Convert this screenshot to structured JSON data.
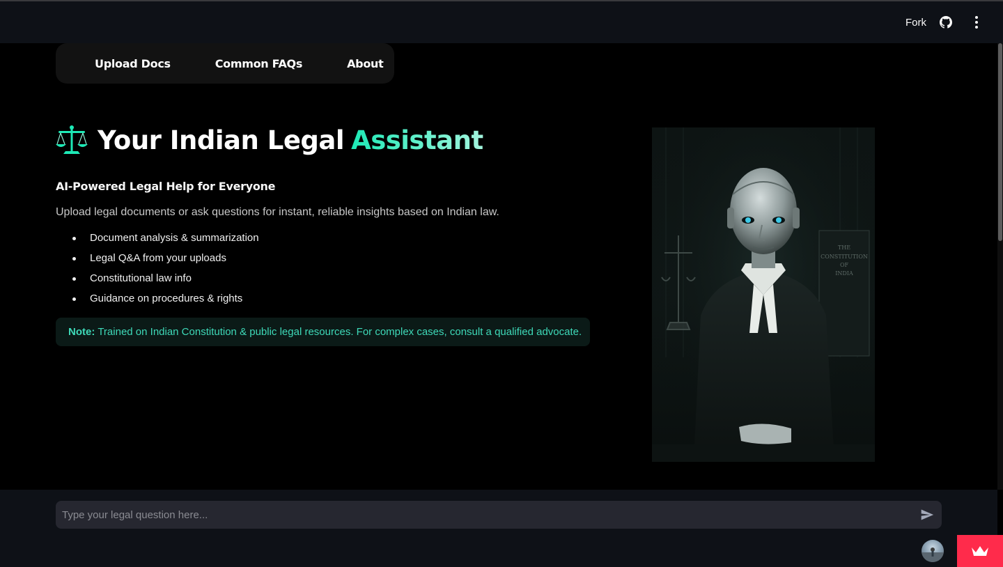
{
  "header": {
    "fork_label": "Fork",
    "github_icon": "github-icon",
    "menu_icon": "kebab-menu-icon"
  },
  "nav": {
    "items": [
      {
        "label": "Upload Docs"
      },
      {
        "label": "Common FAQs"
      },
      {
        "label": "About"
      }
    ]
  },
  "hero": {
    "icon": "scales-icon",
    "title_main": "Your Indian Legal",
    "title_accent": "Assistant",
    "subtitle": "AI-Powered Legal Help for Everyone",
    "description": "Upload legal documents or ask questions for instant, reliable insights based on Indian law.",
    "features": [
      "Document analysis & summarization",
      "Legal Q&A from your uploads",
      "Constitutional law info",
      "Guidance on procedures & rights"
    ],
    "note_label": "Note:",
    "note_text": "Trained on Indian Constitution & public legal resources. For complex cases, consult a qualified advocate."
  },
  "illustration": {
    "book_text": "THE CONSTITUTION OF INDIA"
  },
  "chat": {
    "placeholder": "Type your legal question here...",
    "send_icon": "send-icon"
  },
  "colors": {
    "accent": "#1de9b6",
    "header_bg": "#0e1117",
    "note_text": "#3ed9b8",
    "badge": "#ff2b4b"
  }
}
